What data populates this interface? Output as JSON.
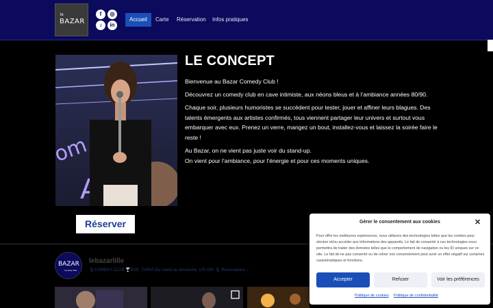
{
  "header": {
    "logo_text": "BAZAR",
    "logo_small": "le",
    "social_icons": [
      "facebook-icon",
      "instagram-icon",
      "tiktok-icon",
      "linkedin-icon"
    ],
    "nav": [
      {
        "label": "Accueil",
        "active": true
      },
      {
        "label": "Carte",
        "active": false
      },
      {
        "label": "Réservation",
        "active": false
      },
      {
        "label": "Infos pratiques",
        "active": false
      }
    ]
  },
  "concept": {
    "title": "LE CONCEPT",
    "p1": "Bienvenue au Bazar Comedy Club !",
    "p2": "Découvrez un comedy club en cave intimiste, aux néons bleus et à l’ambiance années 80/90.",
    "p3": "Chaque soir, plusieurs humoristes se succèdent pour tester, jouer et affiner leurs blagues. Des talents émergents aux artistes confirmés, tous viennent partager leur univers et surtout vous embarquer avec eux. Prenez un verre, mangez un bout, installez-vous et laissez la soirée faire le reste !",
    "p4a": "Au Bazar, on ne vient pas juste voir du stand-up.",
    "p4b": "On vient pour l’ambiance, pour l’énergie et pour ces moments uniques.",
    "reserve_label": "Réserver"
  },
  "instagram": {
    "username": "lebazarlille",
    "bio": "🎙COMEDY CLUB 🍸BAR, TAPAS Du mardi au dimanche, 17h-02h 🎙 Reservations ↓",
    "avatar_text": "BAZAR",
    "avatar_sub": "Comedy Club"
  },
  "consent": {
    "title": "Gérer le consentement aux cookies",
    "text": "Pour offrir les meilleures expériences, nous utilisons des technologies telles que les cookies pour stocker et/ou accéder aux informations des appareils. Le fait de consentir à ces technologies nous permettra de traiter des données telles que le comportement de navigation ou les ID uniques sur ce site. Le fait de ne pas consentir ou de retirer son consentement peut avoir un effet négatif sur certaines caractéristiques et fonctions.",
    "accept": "Accepter",
    "refuse": "Refuser",
    "prefs": "Voir les préférences",
    "link1": "Politique de cookies",
    "link2": "Politique de confidentialité"
  },
  "colors": {
    "header_bg": "#0b0a5c",
    "accent": "#1b4fb8"
  }
}
